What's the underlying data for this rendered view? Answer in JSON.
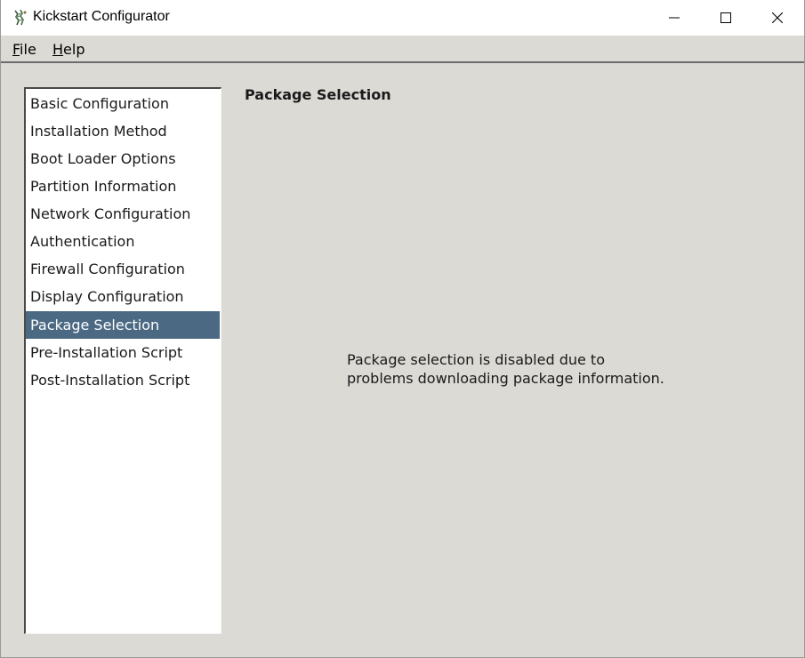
{
  "window": {
    "title": "Kickstart Configurator",
    "icon": "kickstart-app-icon"
  },
  "menubar": {
    "file": {
      "mnemonic": "F",
      "rest": "ile"
    },
    "help": {
      "mnemonic": "H",
      "rest": "elp"
    }
  },
  "sidebar": {
    "items": [
      {
        "label": "Basic Configuration"
      },
      {
        "label": "Installation Method"
      },
      {
        "label": "Boot Loader Options"
      },
      {
        "label": "Partition Information"
      },
      {
        "label": "Network Configuration"
      },
      {
        "label": "Authentication"
      },
      {
        "label": "Firewall Configuration"
      },
      {
        "label": "Display Configuration"
      },
      {
        "label": "Package Selection",
        "selected": true
      },
      {
        "label": "Pre-Installation Script"
      },
      {
        "label": "Post-Installation Script"
      }
    ]
  },
  "main": {
    "title": "Package Selection",
    "message_line1": "Package selection is disabled due to",
    "message_line2": "problems downloading package information."
  },
  "colors": {
    "window_bg": "#dcdad5",
    "selection_bg": "#4b6983",
    "selection_fg": "#ffffff"
  }
}
